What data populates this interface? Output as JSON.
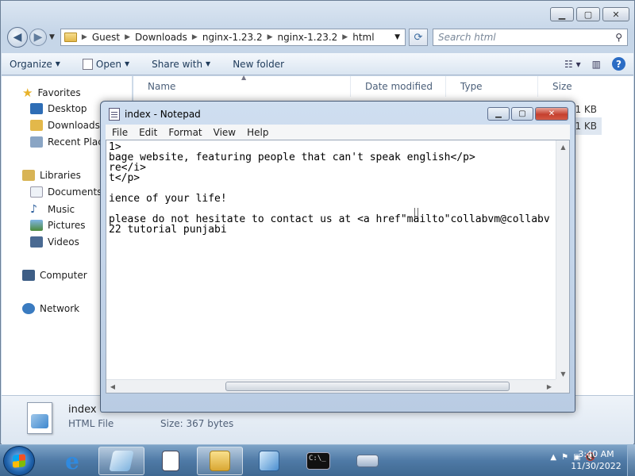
{
  "explorer": {
    "breadcrumbs": [
      "Guest",
      "Downloads",
      "nginx-1.23.2",
      "nginx-1.23.2",
      "html"
    ],
    "search_placeholder": "Search html",
    "toolbar": {
      "organize": "Organize",
      "open": "Open",
      "share_with": "Share with",
      "new_folder": "New folder"
    },
    "nav": {
      "favorites": "Favorites",
      "desktop": "Desktop",
      "downloads": "Downloads",
      "recent_places": "Recent Places",
      "libraries": "Libraries",
      "documents": "Documents",
      "music": "Music",
      "pictures": "Pictures",
      "videos": "Videos",
      "computer": "Computer",
      "network": "Network"
    },
    "columns": {
      "name": "Name",
      "date_modified": "Date modified",
      "type": "Type",
      "size": "Size"
    },
    "rows": [
      {
        "size": "1 KB"
      },
      {
        "size": "1 KB"
      }
    ],
    "details": {
      "name": "index",
      "type": "HTML File",
      "size": "Size: 367 bytes"
    }
  },
  "notepad": {
    "title": "index - Notepad",
    "menu": [
      "File",
      "Edit",
      "Format",
      "View",
      "Help"
    ],
    "lines": [
      "1>",
      "bage website, featuring people that can't speak english</p>",
      "re</i>",
      "t</p>",
      "",
      "ience of your life!",
      "",
      "please do not hesitate to contact us at <a href\"mailto\"collabvm@collabv",
      "22 tutorial punjabi"
    ]
  },
  "taskbar": {
    "clock_time": "3:40 AM",
    "clock_date": "11/30/2022"
  },
  "colors": {
    "titlebar": "#cfdef0",
    "taskbar": "#4f7aa6",
    "close": "#c5402f"
  }
}
